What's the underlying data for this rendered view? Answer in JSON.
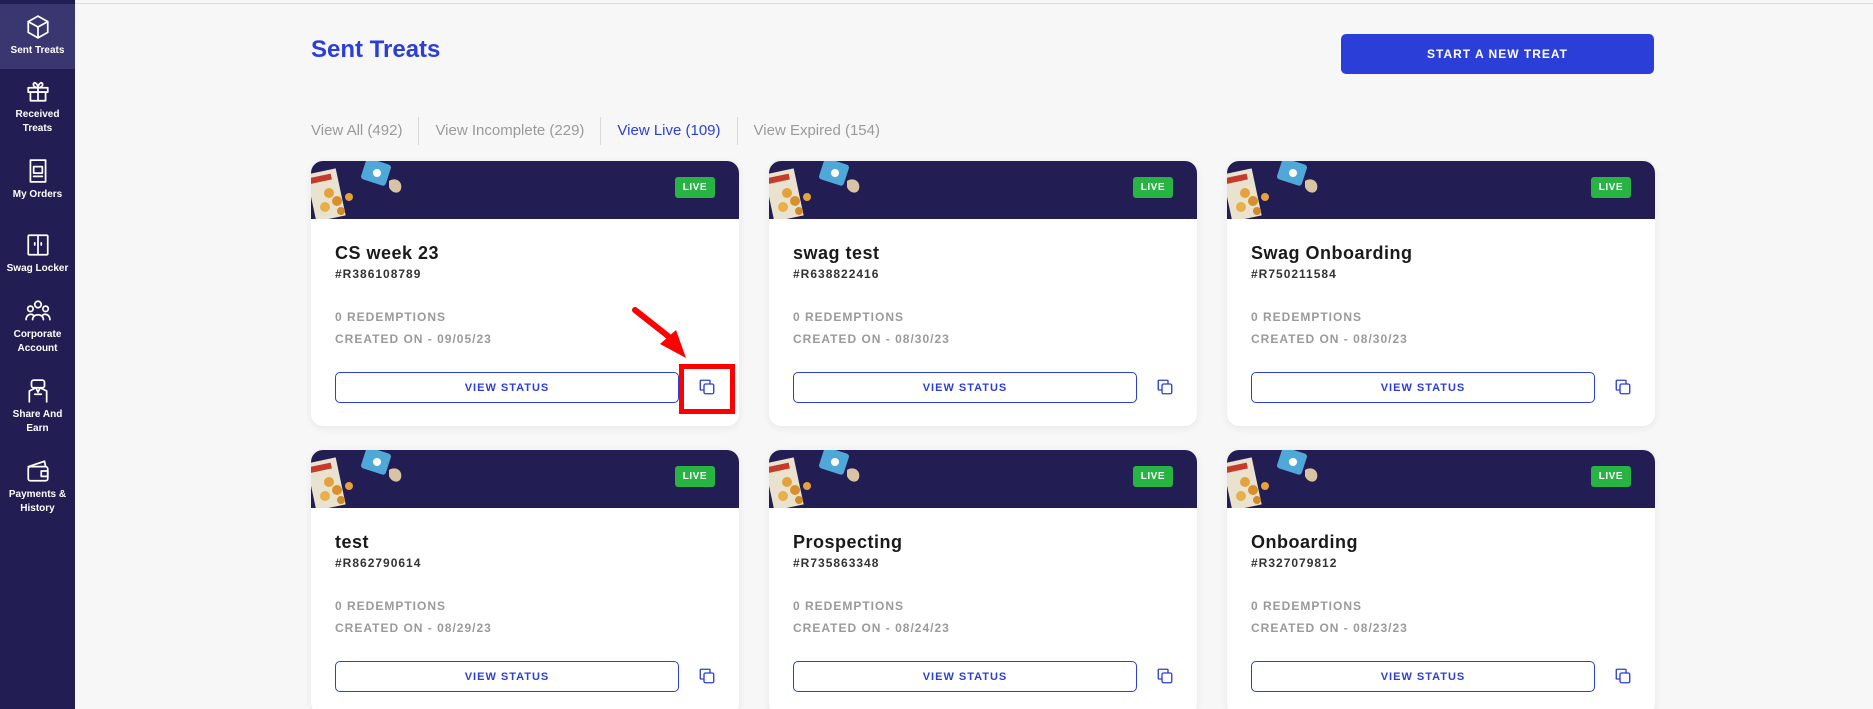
{
  "sidebar": {
    "items": [
      {
        "label": "Sent Treats",
        "icon": "cube-icon",
        "active": true
      },
      {
        "label": "Received Treats",
        "icon": "gift-icon",
        "active": false
      },
      {
        "label": "My Orders",
        "icon": "orders-icon",
        "active": false
      },
      {
        "label": "Swag Locker",
        "icon": "locker-icon",
        "active": false
      },
      {
        "label": "Corporate Account",
        "icon": "team-icon",
        "active": false
      },
      {
        "label": "Share And Earn",
        "icon": "handshake-icon",
        "active": false
      },
      {
        "label": "Payments & History",
        "icon": "wallet-icon",
        "active": false
      }
    ]
  },
  "header": {
    "title": "Sent Treats",
    "new_treat_label": "START A NEW TREAT"
  },
  "tabs": [
    {
      "label": "View All (492)",
      "active": false
    },
    {
      "label": "View Incomplete (229)",
      "active": false
    },
    {
      "label": "View Live (109)",
      "active": true
    },
    {
      "label": "View Expired (154)",
      "active": false
    }
  ],
  "cards": [
    {
      "title": "CS week 23",
      "id": "#R386108789",
      "redemptions": "0 REDEMPTIONS",
      "created": "CREATED ON - 09/05/23",
      "status": "LIVE",
      "button": "VIEW STATUS"
    },
    {
      "title": "swag test",
      "id": "#R638822416",
      "redemptions": "0 REDEMPTIONS",
      "created": "CREATED ON - 08/30/23",
      "status": "LIVE",
      "button": "VIEW STATUS"
    },
    {
      "title": "Swag Onboarding",
      "id": "#R750211584",
      "redemptions": "0 REDEMPTIONS",
      "created": "CREATED ON - 08/30/23",
      "status": "LIVE",
      "button": "VIEW STATUS"
    },
    {
      "title": "test",
      "id": "#R862790614",
      "redemptions": "0 REDEMPTIONS",
      "created": "CREATED ON - 08/29/23",
      "status": "LIVE",
      "button": "VIEW STATUS"
    },
    {
      "title": "Prospecting",
      "id": "#R735863348",
      "redemptions": "0 REDEMPTIONS",
      "created": "CREATED ON - 08/24/23",
      "status": "LIVE",
      "button": "VIEW STATUS"
    },
    {
      "title": "Onboarding",
      "id": "#R327079812",
      "redemptions": "0 REDEMPTIONS",
      "created": "CREATED ON - 08/23/23",
      "status": "LIVE",
      "button": "VIEW STATUS"
    }
  ],
  "colors": {
    "sidebar": "#221d52",
    "accent": "#2b3fd8",
    "live": "#27b443",
    "annotation": "#ff0000"
  }
}
